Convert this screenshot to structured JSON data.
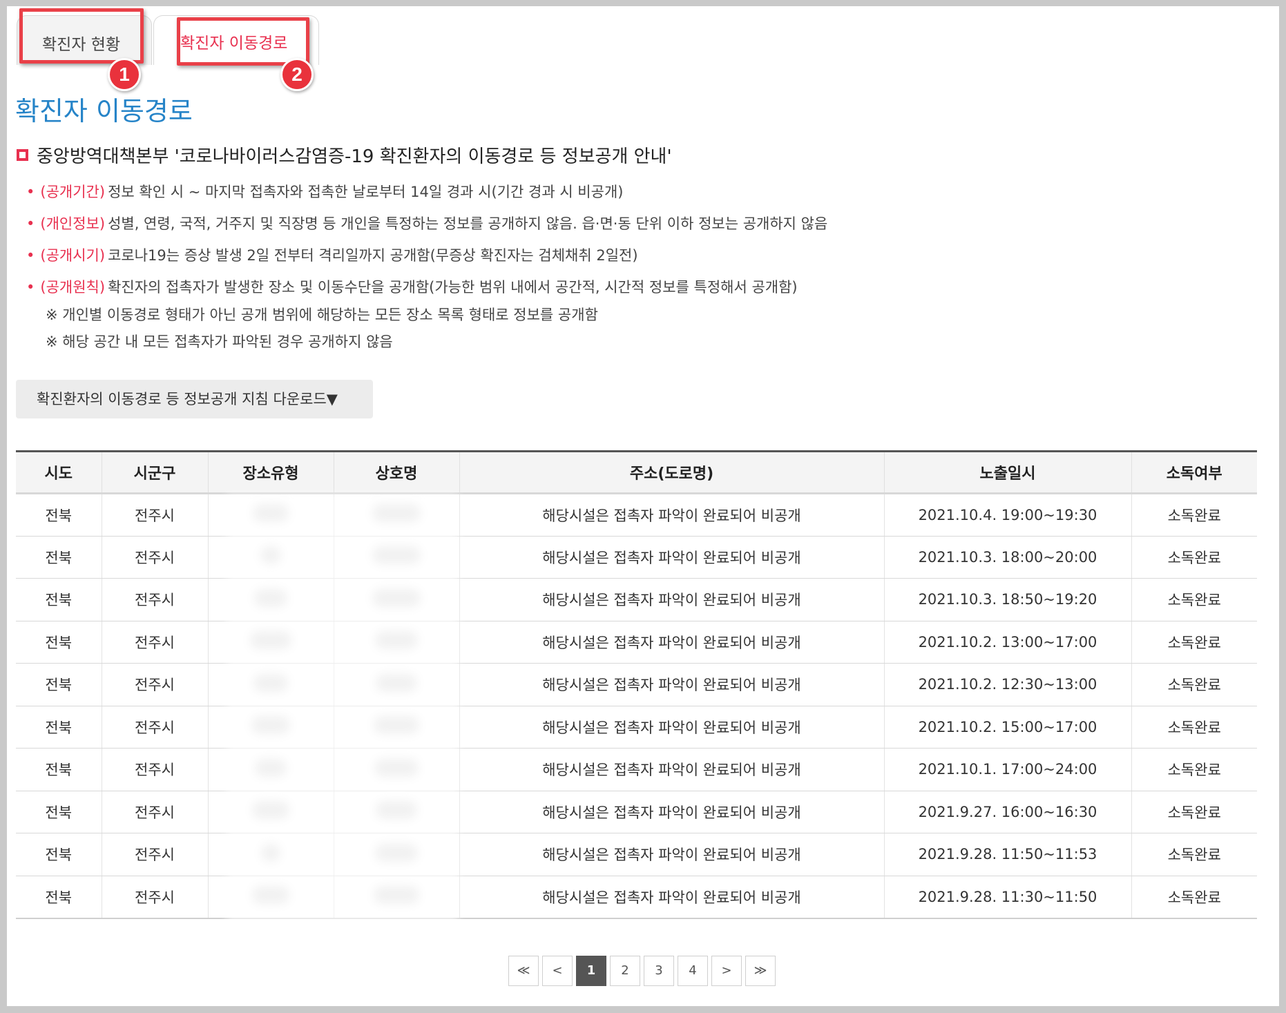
{
  "tabs": [
    {
      "label": "확진자 현황"
    },
    {
      "label": "확진자 이동경로"
    }
  ],
  "badges": [
    "1",
    "2"
  ],
  "page_title": "확진자 이동경로",
  "section_heading": "중앙방역대책본부 '코로나바이러스감염증-19 확진환자의 이동경로 등 정보공개 안내'",
  "notices": [
    {
      "tag": "(공개기간)",
      "text": "정보 확인 시 ~ 마지막 접촉자와 접촉한 날로부터 14일 경과 시(기간 경과 시 비공개)"
    },
    {
      "tag": "(개인정보)",
      "text": "성별, 연령, 국적, 거주지 및 직장명 등 개인을 특정하는 정보를 공개하지 않음. 읍·면·동 단위 이하 정보는 공개하지 않음"
    },
    {
      "tag": "(공개시기)",
      "text": "코로나19는 증상 발생 2일 전부터 격리일까지 공개함(무증상 확진자는 검체채취 2일전)"
    },
    {
      "tag": "(공개원칙)",
      "text": "확진자의 접촉자가 발생한 장소 및 이동수단을 공개함(가능한 범위 내에서 공간적, 시간적 정보를 특정해서 공개함)"
    }
  ],
  "notes": [
    "※ 개인별 이동경로 형태가 아닌 공개 범위에 해당하는 모든 장소 목록 형태로 정보를 공개함",
    "※ 해당 공간 내 모든 접촉자가 파악된 경우 공개하지 않음"
  ],
  "download_button": "확진환자의 이동경로 등 정보공개 지침 다운로드▼",
  "table": {
    "headers": [
      "시도",
      "시군구",
      "장소유형",
      "상호명",
      "주소(도로명)",
      "노출일시",
      "소독여부"
    ],
    "rows": [
      {
        "sido": "전북",
        "sigungu": "전주시",
        "address": "해당시설은 접촉자 파악이 완료되어 비공개",
        "datetime": "2021.10.4.  19:00~19:30",
        "status": "소독완료"
      },
      {
        "sido": "전북",
        "sigungu": "전주시",
        "address": "해당시설은 접촉자 파악이 완료되어 비공개",
        "datetime": "2021.10.3.  18:00~20:00",
        "status": "소독완료"
      },
      {
        "sido": "전북",
        "sigungu": "전주시",
        "address": "해당시설은 접촉자 파악이 완료되어 비공개",
        "datetime": "2021.10.3.  18:50~19:20",
        "status": "소독완료"
      },
      {
        "sido": "전북",
        "sigungu": "전주시",
        "address": "해당시설은 접촉자 파악이 완료되어 비공개",
        "datetime": "2021.10.2.  13:00~17:00",
        "status": "소독완료"
      },
      {
        "sido": "전북",
        "sigungu": "전주시",
        "address": "해당시설은 접촉자 파악이 완료되어 비공개",
        "datetime": "2021.10.2.  12:30~13:00",
        "status": "소독완료"
      },
      {
        "sido": "전북",
        "sigungu": "전주시",
        "address": "해당시설은 접촉자 파악이 완료되어 비공개",
        "datetime": "2021.10.2.  15:00~17:00",
        "status": "소독완료"
      },
      {
        "sido": "전북",
        "sigungu": "전주시",
        "address": "해당시설은 접촉자 파악이 완료되어 비공개",
        "datetime": "2021.10.1.  17:00~24:00",
        "status": "소독완료"
      },
      {
        "sido": "전북",
        "sigungu": "전주시",
        "address": "해당시설은 접촉자 파악이 완료되어 비공개",
        "datetime": "2021.9.27. 16:00~16:30",
        "status": "소독완료"
      },
      {
        "sido": "전북",
        "sigungu": "전주시",
        "address": "해당시설은 접촉자 파악이 완료되어 비공개",
        "datetime": "2021.9.28. 11:50~11:53",
        "status": "소독완료"
      },
      {
        "sido": "전북",
        "sigungu": "전주시",
        "address": "해당시설은 접촉자 파악이 완료되어 비공개",
        "datetime": "2021.9.28. 11:30~11:50",
        "status": "소독완료"
      }
    ]
  },
  "pagination": {
    "first": "≪",
    "prev": "<",
    "pages": [
      "1",
      "2",
      "3",
      "4"
    ],
    "current": "1",
    "next": ">",
    "last": "≫"
  },
  "colors": {
    "accent_blue": "#2684c8",
    "accent_red": "#e8304f",
    "highlight_red": "#e94048"
  }
}
